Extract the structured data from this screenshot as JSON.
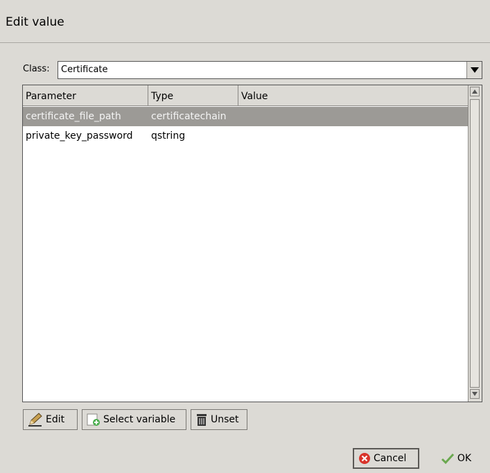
{
  "window": {
    "title": "Edit value"
  },
  "class_field": {
    "label": "Class:",
    "value": "Certificate"
  },
  "table": {
    "columns": [
      "Parameter",
      "Type",
      "Value"
    ],
    "rows": [
      {
        "parameter": "certificate_file_path",
        "type": "certificatechain",
        "value": "",
        "selected": true
      },
      {
        "parameter": "private_key_password",
        "type": "qstring",
        "value": "",
        "selected": false
      }
    ]
  },
  "actions": {
    "edit": "Edit",
    "select_variable": "Select variable",
    "unset": "Unset"
  },
  "dialog_buttons": {
    "cancel": "Cancel",
    "ok": "OK"
  },
  "icons": {
    "edit": "pencil-icon",
    "select_variable": "add-variable-icon",
    "unset": "trash-icon",
    "cancel": "cancel-icon",
    "ok": "check-icon"
  },
  "colors": {
    "selection": "#9c9a96",
    "background": "#dcdad5"
  }
}
